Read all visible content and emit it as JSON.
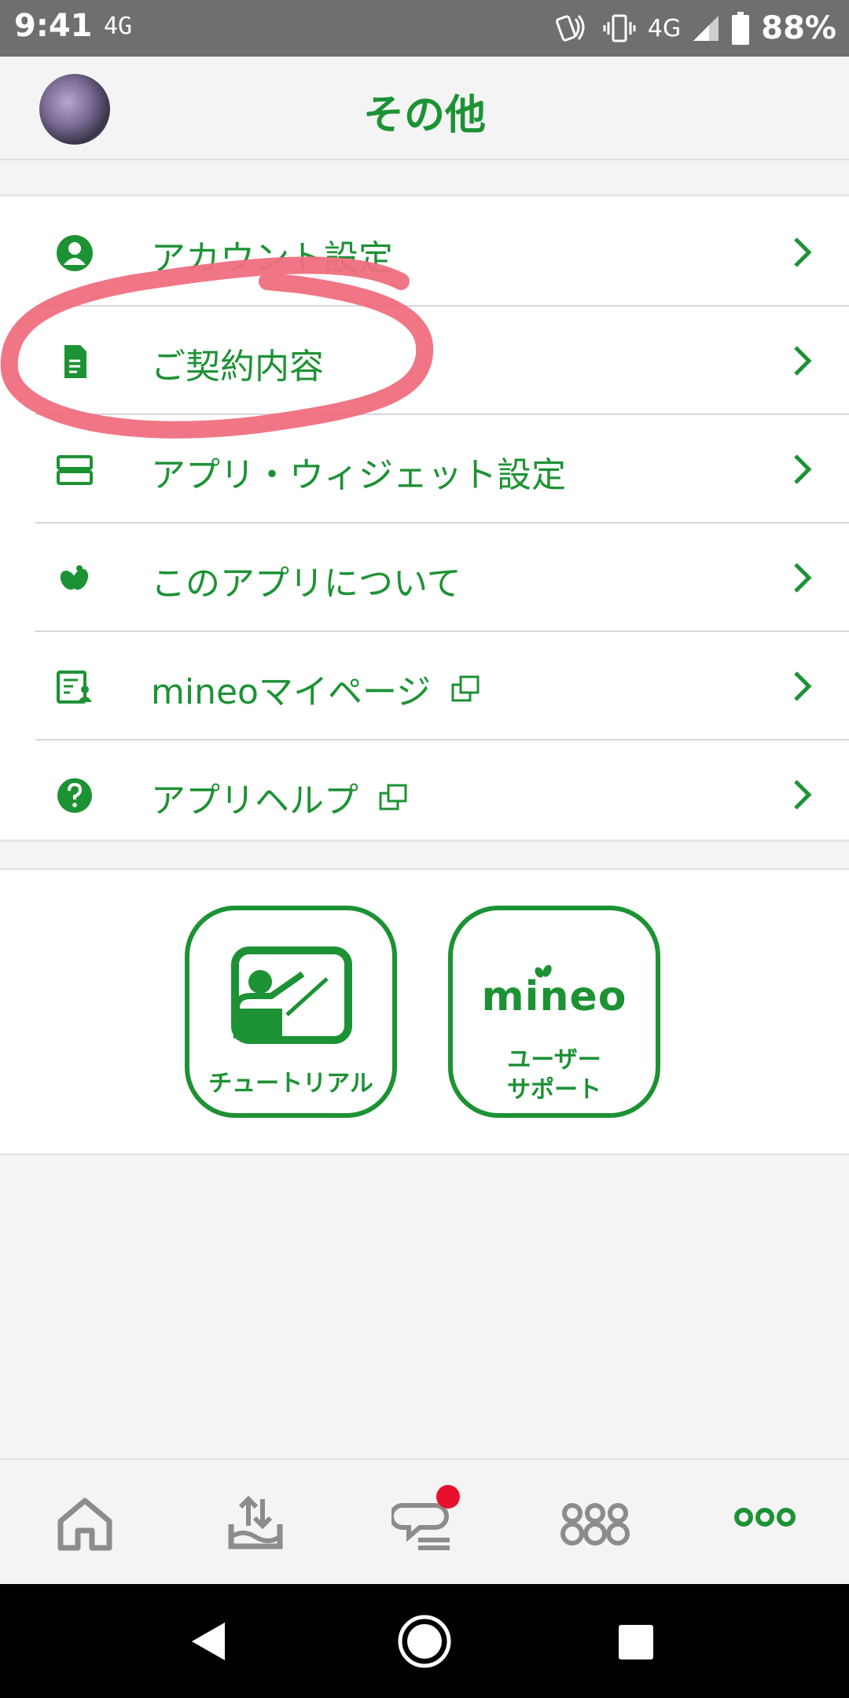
{
  "status_bar": {
    "time": "9:41",
    "network_left": "4G",
    "network_right": "4G",
    "battery": "88%",
    "icons": [
      "nfc-icon",
      "vibrate-icon",
      "signal-icon",
      "battery-icon"
    ]
  },
  "header": {
    "title": "その他",
    "avatar": "avatar"
  },
  "menu": {
    "items": [
      {
        "label": "アカウント設定",
        "icon": "account-icon",
        "external": false
      },
      {
        "label": "ご契約内容",
        "icon": "contract-document-icon",
        "external": false
      },
      {
        "label": "アプリ・ウィジェット設定",
        "icon": "widget-settings-icon",
        "external": false
      },
      {
        "label": "このアプリについて",
        "icon": "mineo-logo-icon",
        "external": false
      },
      {
        "label": "mineoマイページ",
        "icon": "mypage-icon",
        "external": true
      },
      {
        "label": "アプリヘルプ",
        "icon": "help-icon",
        "external": true
      }
    ]
  },
  "quick_links": {
    "tutorial_label": "チュートリアル",
    "support_brand": "mineo",
    "support_line1": "ユーザー",
    "support_line2": "サポート"
  },
  "bottom_nav": {
    "items": [
      "home-icon",
      "data-transfer-icon",
      "community-icon",
      "apps-icon",
      "more-icon"
    ],
    "active": "more-icon",
    "badge_on": "community-icon"
  },
  "colors": {
    "accent": "#1d9234",
    "annotation": "#ef6f7f",
    "inactive_icon": "#8c8c8c",
    "badge": "#e8112d"
  }
}
